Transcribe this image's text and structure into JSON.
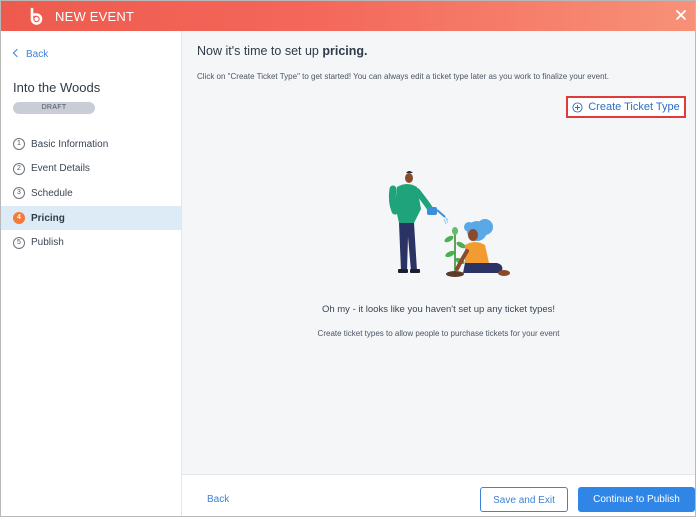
{
  "header": {
    "title": "NEW EVENT",
    "gradient": [
      "#ee5a4e",
      "#f79178"
    ],
    "logo_icon": "b-logo-icon",
    "close_icon": "close-icon"
  },
  "sidebar": {
    "back_label": "Back",
    "event_name": "Into the Woods",
    "status_badge": "DRAFT",
    "steps": [
      {
        "number": "1",
        "label": "Basic Information",
        "active": false
      },
      {
        "number": "2",
        "label": "Event Details",
        "active": false
      },
      {
        "number": "3",
        "label": "Schedule",
        "active": false
      },
      {
        "number": "4",
        "label": "Pricing",
        "active": true
      },
      {
        "number": "5",
        "label": "Publish",
        "active": false
      }
    ],
    "active_color": "#f47a3b",
    "active_bg": "#ddebf7"
  },
  "main": {
    "title_prefix": "Now it's time to set up ",
    "title_bold": "pricing.",
    "description": "Click on \"Create Ticket Type\" to get started! You can always edit a ticket type later as you work to finalize your event.",
    "create_button_label": "Create Ticket Type",
    "create_button_icon": "plus-circle-icon",
    "empty_state": {
      "title": "Oh my - it looks like you haven't set up any ticket types!",
      "subtitle": "Create ticket types to allow people to purchase tickets for your event"
    }
  },
  "footer": {
    "back_label": "Back",
    "save_label": "Save and Exit",
    "continue_label": "Continue to Publish",
    "accent": "#2f86e6"
  }
}
